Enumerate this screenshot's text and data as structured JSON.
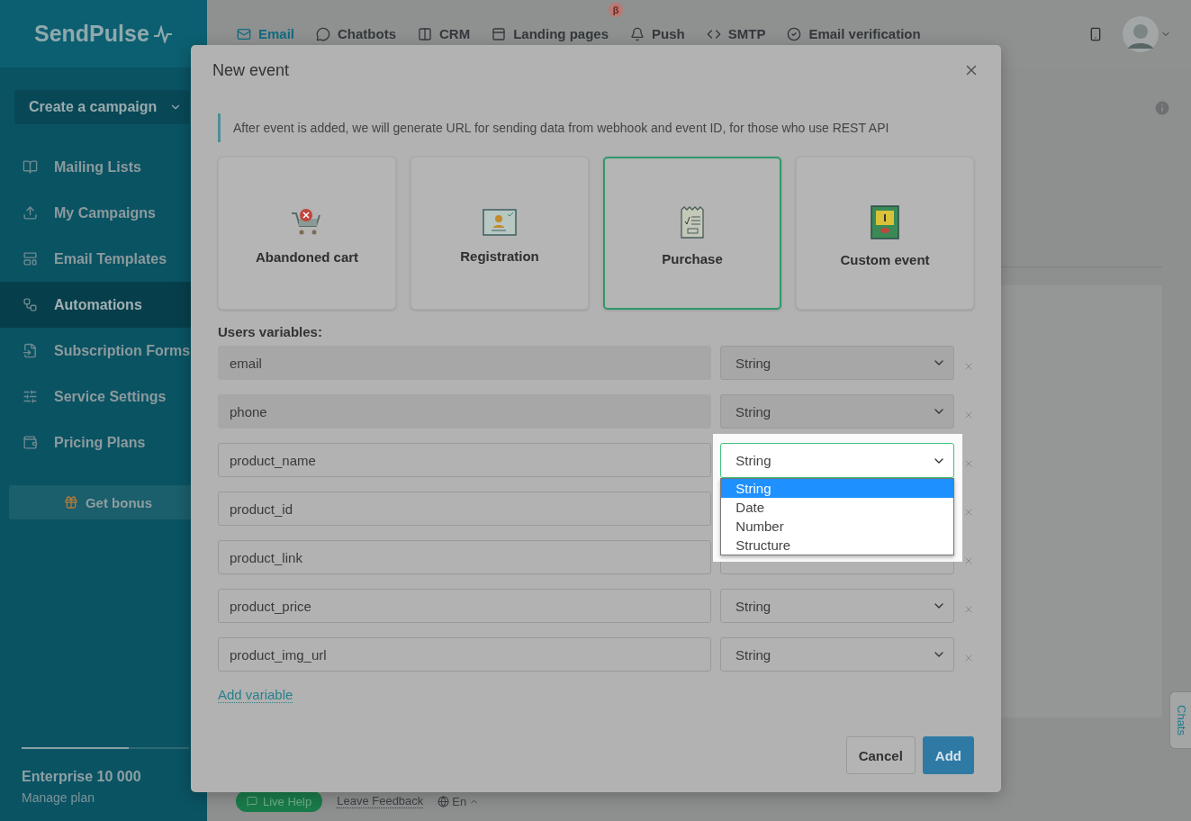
{
  "app": {
    "logo": "SendPulse"
  },
  "nav": [
    {
      "label": "Email",
      "selected": true
    },
    {
      "label": "Chatbots",
      "selected": false
    },
    {
      "label": "CRM",
      "selected": false
    },
    {
      "label": "Landing pages",
      "selected": false,
      "badge": "β"
    },
    {
      "label": "Push",
      "selected": false
    },
    {
      "label": "SMTP",
      "selected": false
    },
    {
      "label": "Email verification",
      "selected": false
    }
  ],
  "sidebar": {
    "create_button": "Create a campaign",
    "items": [
      {
        "label": "Mailing Lists",
        "selected": false
      },
      {
        "label": "My Campaigns",
        "selected": false
      },
      {
        "label": "Email Templates",
        "selected": false
      },
      {
        "label": "Automations",
        "selected": true
      },
      {
        "label": "Subscription Forms",
        "selected": false
      },
      {
        "label": "Service Settings",
        "selected": false
      },
      {
        "label": "Pricing Plans",
        "selected": false
      }
    ],
    "bonus": "Get bonus",
    "plan": "Enterprise 10 000",
    "level": 0.64,
    "manage": "Manage plan"
  },
  "footer": {
    "live_help": "Live Help",
    "feedback": "Leave Feedback",
    "language": "En"
  },
  "side_tab": "Chats",
  "modal": {
    "title": "New event",
    "info": "After event is added, we will generate URL for sending data from webhook and event ID, for those who use REST API",
    "event_types": [
      {
        "label": "Abandoned cart",
        "kind": "cart",
        "selected": false
      },
      {
        "label": "Registration",
        "kind": "registration",
        "selected": false
      },
      {
        "label": "Purchase",
        "kind": "receipt",
        "selected": true
      },
      {
        "label": "Custom event",
        "kind": "custom",
        "selected": false
      }
    ],
    "variables_label": "Users variables:",
    "variables": [
      {
        "name": "email",
        "type": "String",
        "disabled": true,
        "open": false
      },
      {
        "name": "phone",
        "type": "String",
        "disabled": true,
        "open": false
      },
      {
        "name": "product_name",
        "type": "String",
        "disabled": false,
        "open": true
      },
      {
        "name": "product_id",
        "disabled": false,
        "open": false
      },
      {
        "name": "product_link",
        "disabled": false,
        "open": false
      },
      {
        "name": "product_price",
        "type": "String",
        "disabled": false,
        "open": false
      },
      {
        "name": "product_img_url",
        "type": "String",
        "disabled": false,
        "open": false
      }
    ],
    "dropdown_options": [
      {
        "label": "String",
        "selected": true
      },
      {
        "label": "Date",
        "selected": false
      },
      {
        "label": "Number",
        "selected": false
      },
      {
        "label": "Structure",
        "selected": false
      }
    ],
    "add_variable": "Add variable",
    "cancel": "Cancel",
    "add": "Add"
  }
}
